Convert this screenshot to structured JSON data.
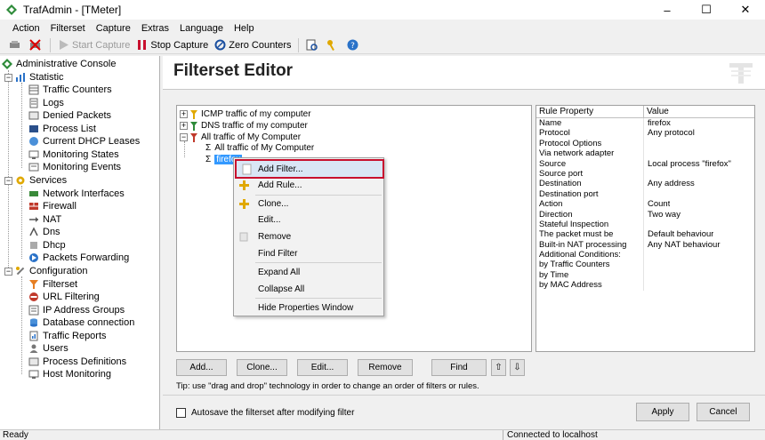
{
  "window": {
    "title": "TrafAdmin - [TMeter]",
    "minimize_glyph": "–",
    "maximize_glyph": "☐",
    "close_glyph": "✕"
  },
  "menu": [
    "Action",
    "Filterset",
    "Capture",
    "Extras",
    "Language",
    "Help"
  ],
  "toolbar": {
    "start_capture": "Start Capture",
    "stop_capture": "Stop Capture",
    "zero_counters": "Zero Counters"
  },
  "tree": {
    "root": "Administrative Console",
    "statistic": "Statistic",
    "statistic_items": [
      "Traffic Counters",
      "Logs",
      "Denied Packets",
      "Process List",
      "Current DHCP Leases",
      "Monitoring States",
      "Monitoring Events"
    ],
    "services": "Services",
    "services_items": [
      "Network Interfaces",
      "Firewall",
      "NAT",
      "Dns",
      "Dhcp",
      "Packets Forwarding"
    ],
    "configuration": "Configuration",
    "configuration_items": [
      "Filterset",
      "URL Filtering",
      "IP Address Groups",
      "Database connection",
      "Traffic Reports",
      "Users",
      "Process Definitions",
      "Host Monitoring"
    ]
  },
  "editor": {
    "title": "Filterset Editor",
    "filters": [
      "ICMP traffic of my computer",
      "DNS traffic of my computer",
      "All traffic of My Computer"
    ],
    "rules": [
      "All traffic of My Computer",
      "firefox"
    ],
    "props_header": [
      "Rule Property",
      "Value"
    ],
    "props": [
      [
        "Name",
        "firefox"
      ],
      [
        "Protocol",
        "Any protocol"
      ],
      [
        "Protocol Options",
        ""
      ],
      [
        "Via network adapter",
        ""
      ],
      [
        "Source",
        "Local process \"firefox\""
      ],
      [
        "Source port",
        ""
      ],
      [
        "Destination",
        "Any address"
      ],
      [
        "Destination port",
        ""
      ],
      [
        "Action",
        "Count"
      ],
      [
        "Direction",
        "Two way"
      ],
      [
        "Stateful Inspection",
        ""
      ],
      [
        "The packet must be",
        "Default behaviour"
      ],
      [
        "Built-in NAT processing",
        "Any NAT behaviour"
      ],
      [
        "Additional Conditions:",
        ""
      ],
      [
        "  by Traffic Counters",
        ""
      ],
      [
        "  by Time",
        ""
      ],
      [
        "  by MAC Address",
        ""
      ]
    ],
    "buttons": {
      "add": "Add...",
      "clone": "Clone...",
      "edit": "Edit...",
      "remove": "Remove",
      "find": "Find",
      "up": "⇧",
      "down": "⇩"
    },
    "tip": "Tip: use \"drag and drop\" technology in order to change an order of filters or rules.",
    "autosave": "Autosave the filterset after modifying filter",
    "apply": "Apply",
    "cancel": "Cancel"
  },
  "context_menu": {
    "add_filter": "Add Filter...",
    "add_rule": "Add Rule...",
    "clone": "Clone...",
    "edit": "Edit...",
    "remove": "Remove",
    "find_filter": "Find Filter",
    "expand_all": "Expand All",
    "collapse_all": "Collapse All",
    "hide_props": "Hide Properties Window"
  },
  "status": {
    "left": "Ready",
    "right": "Connected to localhost"
  }
}
